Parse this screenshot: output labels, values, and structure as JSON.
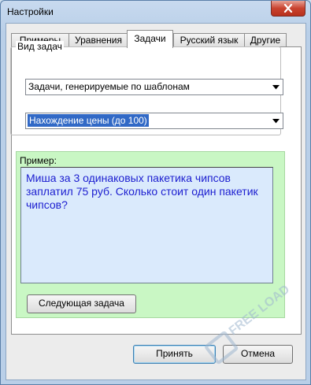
{
  "window": {
    "title": "Настройки"
  },
  "tabs": [
    {
      "label": "Примеры"
    },
    {
      "label": "Уравнения"
    },
    {
      "label": "Задачи"
    },
    {
      "label": "Русский язык"
    },
    {
      "label": "Другие"
    }
  ],
  "task_type": {
    "group_label": "Вид задач",
    "kind_value": "Задачи, генерируемые по шаблонам",
    "template_value": "Нахождение цены (до 100)"
  },
  "example": {
    "label": "Пример:",
    "text": "Миша за 3 одинаковых пакетика чипсов заплатил 75 руб. Сколько стоит один пакетик чипсов?",
    "next_button": "Следующая задача"
  },
  "footer": {
    "accept_button": "Принять",
    "cancel_button": "Отмена"
  },
  "watermark": {
    "text": "FREE LOAD"
  },
  "colors": {
    "example_bg": "#c9f7c4",
    "text_blue": "#1c1ed0",
    "selection": "#3169c6"
  }
}
